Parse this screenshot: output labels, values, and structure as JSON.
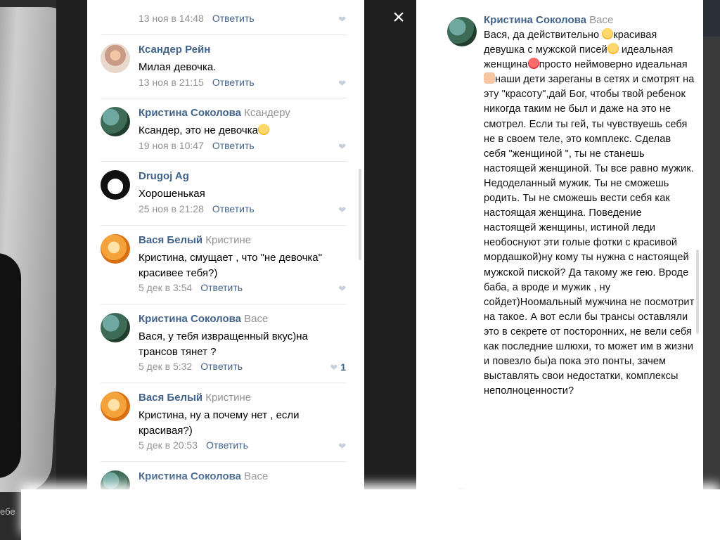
{
  "viewer": {
    "close_label": "×",
    "caption_left": "ебе"
  },
  "left_comments": [
    {
      "author": "",
      "reply_to": "",
      "text": "",
      "date": "13 ноя в 14:48",
      "reply_label": "Ответить",
      "likes": ""
    },
    {
      "author": "Ксандер Рейн",
      "reply_to": "",
      "text": "Милая девочка.",
      "date": "13 ноя в 21:15",
      "reply_label": "Ответить",
      "likes": ""
    },
    {
      "author": "Кристина Соколова",
      "reply_to": "Ксандеру",
      "text": "Ксандер, это не девочка",
      "date": "19 ноя в 10:47",
      "reply_label": "Ответить",
      "likes": ""
    },
    {
      "author": "Drugoj Ag",
      "reply_to": "",
      "text": "Хорошенькая",
      "date": "25 ноя в 21:28",
      "reply_label": "Ответить",
      "likes": ""
    },
    {
      "author": "Вася Белый",
      "reply_to": "Кристине",
      "text": "Кристина, смущает , что \"не девочка\" красивее тебя?)",
      "date": "5 дек в 3:54",
      "reply_label": "Ответить",
      "likes": ""
    },
    {
      "author": "Кристина Соколова",
      "reply_to": "Васе",
      "text": "Вася, у тебя извращенный вкус)на трансов тянет ?",
      "date": "5 дек в 5:32",
      "reply_label": "Ответить",
      "likes": "1"
    },
    {
      "author": "Вася Белый",
      "reply_to": "Кристине",
      "text": "Кристина, ну а почему нет , если красивая?)",
      "date": "5 дек в 20:53",
      "reply_label": "Ответить",
      "likes": ""
    },
    {
      "author": "Кристина Соколова",
      "reply_to": "Васе",
      "text": "",
      "date": "",
      "reply_label": "",
      "likes": ""
    }
  ],
  "right_comment": {
    "author": "Кристина Соколова",
    "reply_to": "Васе",
    "text_1": "Вася, да действительно ",
    "text_2": "красивая девушка с мужской писей",
    "text_3": " идеальная женщина",
    "text_4": "просто неймоверно идеальная",
    "text_5": "наши дети зареганы в сетях и смотрят на эту \"красоту\",дай Бог, чтобы твой ребенок никогда таким не был и даже на это не смотрел. Если ты гей, ты чувствуешь себя не в своем теле, это комплекс. Сделав себя \"женщиной \", ты не станешь настоящей женщиной. Ты все равно мужик. Недоделанный мужик. Ты не сможешь родить. Ты не сможешь вести себя как настоящая женщина. Поведение настоящей женщины, истиной леди необоснуют эти голые фотки с красивой мордашкой)ну кому ты нужна с настоящей мужской пиской? Да такому же гею. Вроде баба, а вроде и мужик , ну сойдет)Ноомальный мужчина не посмотрит на такое. А вот если бы трансы оставляли это в секрете от посторонних, не вели себя как последние шлюхи, то может им в жизни и повезло бы)а пока это понты, зачем выставлять свои недостатки, комплексы неполноценности?"
  }
}
